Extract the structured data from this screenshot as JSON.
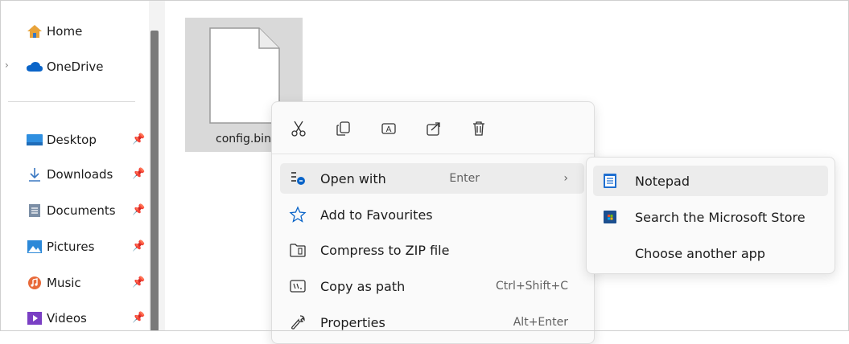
{
  "sidebar": {
    "items": [
      {
        "label": "Home",
        "icon": "home-icon"
      },
      {
        "label": "OneDrive",
        "icon": "onedrive-cloud-icon"
      },
      {
        "label": "Desktop",
        "icon": "desktop-folder-icon",
        "pinned": true
      },
      {
        "label": "Downloads",
        "icon": "download-arrow-icon",
        "pinned": true
      },
      {
        "label": "Documents",
        "icon": "documents-icon",
        "pinned": true
      },
      {
        "label": "Pictures",
        "icon": "pictures-icon",
        "pinned": true
      },
      {
        "label": "Music",
        "icon": "music-icon",
        "pinned": true
      },
      {
        "label": "Videos",
        "icon": "videos-icon",
        "pinned": true
      }
    ]
  },
  "file": {
    "name": "config.bin",
    "selected": true
  },
  "context_menu": {
    "quick_actions": [
      {
        "name": "cut",
        "icon": "scissors-icon"
      },
      {
        "name": "copy",
        "icon": "copy-icon"
      },
      {
        "name": "rename",
        "icon": "rename-icon"
      },
      {
        "name": "share",
        "icon": "share-icon"
      },
      {
        "name": "delete",
        "icon": "trash-icon"
      }
    ],
    "items": [
      {
        "label": "Open with",
        "shortcut": "Enter",
        "has_submenu": true,
        "icon": "open-with-icon"
      },
      {
        "label": "Add to Favourites",
        "shortcut": "",
        "icon": "star-icon"
      },
      {
        "label": "Compress to ZIP file",
        "shortcut": "",
        "icon": "zip-folder-icon"
      },
      {
        "label": "Copy as path",
        "shortcut": "Ctrl+Shift+C",
        "icon": "copy-path-icon"
      },
      {
        "label": "Properties",
        "shortcut": "Alt+Enter",
        "icon": "wrench-icon"
      }
    ]
  },
  "submenu": {
    "items": [
      {
        "label": "Notepad",
        "icon": "notepad-icon"
      },
      {
        "label": "Search the Microsoft Store",
        "icon": "microsoft-store-icon"
      },
      {
        "label": "Choose another app",
        "icon": ""
      }
    ]
  },
  "colors": {
    "accent": "#0067c0",
    "hover": "#ececec",
    "selection": "#d9d9d9"
  }
}
